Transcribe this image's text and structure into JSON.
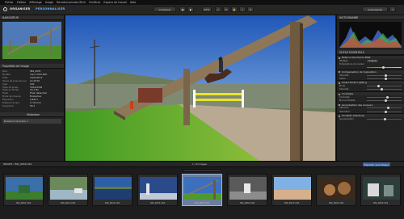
{
  "menubar": {
    "items": [
      "Fichier",
      "Edition",
      "Affichage",
      "Image",
      "Recadrer/pivoter/PerV",
      "Fenêtres",
      "Espace de travail",
      "Aide"
    ]
  },
  "toolbar": {
    "module_organize": "ORGANISER",
    "module_customize": "PERSONNALISER",
    "compare_label": "Comparer",
    "zoom_label": "67%",
    "workspace_label": "Avant/Après"
  },
  "left_panel": {
    "browser_header": "NAVIGATEUR",
    "properties_header": "Propriétés de l'image",
    "properties": [
      {
        "k": "Nom",
        "v": "IMG_6655"
      },
      {
        "k": "Modèle",
        "v": "Canon EOS 60D"
      },
      {
        "k": "Date",
        "v": "12/01/2013"
      },
      {
        "k": "Heure de prise de vue",
        "v": "14:26:00"
      },
      {
        "k": "Type",
        "v": "CR2"
      },
      {
        "k": "Taille de pixels",
        "v": "5184x3456"
      },
      {
        "k": "Taille du fichier",
        "v": "23,1 Mo"
      },
      {
        "k": "Flash",
        "v": "Flash désactivé"
      },
      {
        "k": "Mode de mesure",
        "v": "Évaluative"
      },
      {
        "k": "Exposition",
        "v": "1/640 s"
      },
      {
        "k": "Distance focale",
        "v": "17.00 mm"
      },
      {
        "k": "Ouverture",
        "v": "f/6.3"
      }
    ],
    "history_header": "Historique",
    "history_item": "Demand Correction 1"
  },
  "right_panel": {
    "histogram_header": "HISTOGRAMME",
    "tools_header": "OUTILS ESSENTIELS",
    "preset_label": "Balance des blancs RAW",
    "settings": [
      {
        "label": "Réglage",
        "value": "Original"
      },
      {
        "label": "Température de couleur",
        "value": ""
      }
    ],
    "sections": [
      {
        "title": "Compensation de l'exposition",
        "rows": [
          "Intensité",
          "Valeur"
        ]
      },
      {
        "title": "Smart Smart Lighting",
        "rows": [
          "Mode",
          "Intensité"
        ]
      },
      {
        "title": "Contraste",
        "rows": [
          "Contraste",
          "Microcontraste"
        ]
      },
      {
        "title": "Accentuation des couleurs",
        "rows": [
          "Vibrance",
          "Saturation"
        ]
      },
      {
        "title": "Tonalités sélectives",
        "rows": [
          "Surexposition"
        ]
      }
    ]
  },
  "filmstrip": {
    "path_label": "IMAGES › IMG_6655.CR2",
    "count_label": "1 / 8 images",
    "export_label": "Exporter vers disque",
    "thumbs": [
      {
        "name": "IMG_6601.CR2"
      },
      {
        "name": "IMG_6610.CR2"
      },
      {
        "name": "IMG_6622.CR2"
      },
      {
        "name": "IMG_6634.CR2"
      },
      {
        "name": "IMG_6655.CR2"
      },
      {
        "name": "IMG_6660.CR2"
      },
      {
        "name": "IMG_6672.CR2"
      },
      {
        "name": "IMG_6681.CR2"
      },
      {
        "name": "IMG_6690.CR2"
      }
    ]
  },
  "colors": {
    "accent": "#f0a24a",
    "selection": "#6b7d9f",
    "panel": "#232323"
  }
}
